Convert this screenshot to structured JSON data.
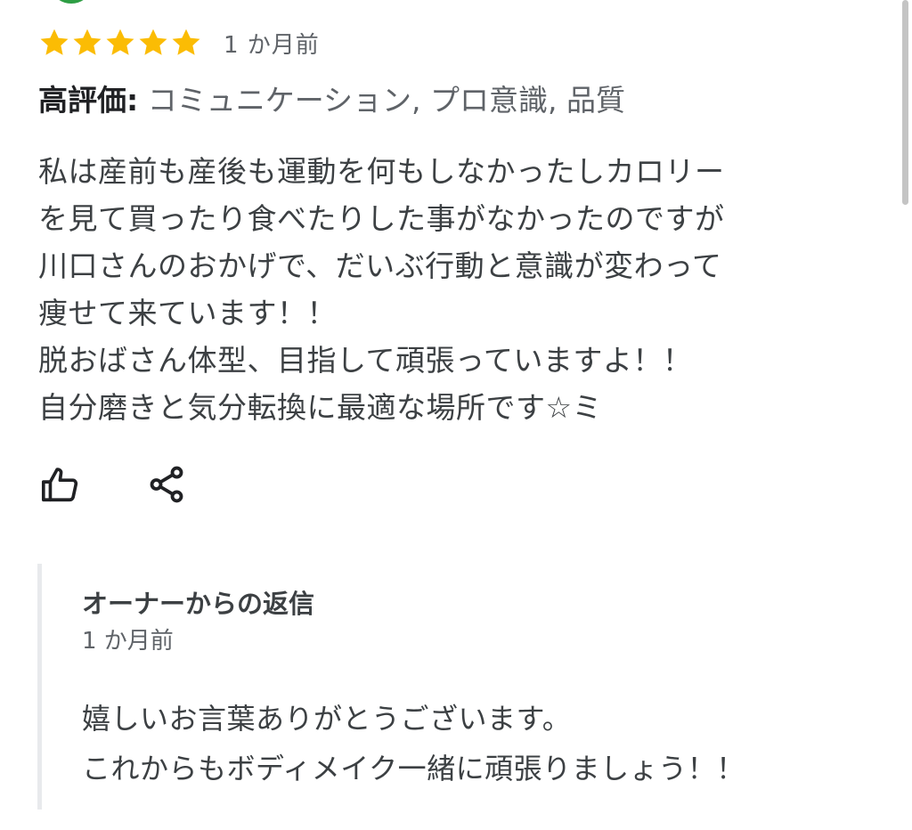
{
  "review": {
    "rating": 5,
    "max_rating": 5,
    "date": "1 か月前",
    "highlights_label": "高評価:",
    "highlights_values": "コミュニケーション, プロ意識, 品質",
    "text_lines": [
      "私は産前も産後も運動を何もしなかったしカロリー",
      "を見て買ったり食べたりした事がなかったのですが",
      "川口さんのおかげで、だいぶ行動と意識が変わって",
      "痩せて来ています！！",
      "脱おばさん体型、目指して頑張っていますよ！！",
      "自分磨きと気分転換に最適な場所です☆ミ"
    ],
    "actions": [
      {
        "icon": "thumbs-up-icon"
      },
      {
        "icon": "share-icon"
      }
    ]
  },
  "owner_reply": {
    "title": "オーナーからの返信",
    "date": "1 か月前",
    "text_lines": [
      "嬉しいお言葉ありがとうございます。",
      "これからもボディメイク一緒に頑張りましょう！！"
    ]
  },
  "colors": {
    "star": "#fbbc04",
    "text": "#3c4043",
    "muted": "#5f6368",
    "reply_border": "#e8eaed",
    "avatar": "#2e9e44"
  }
}
